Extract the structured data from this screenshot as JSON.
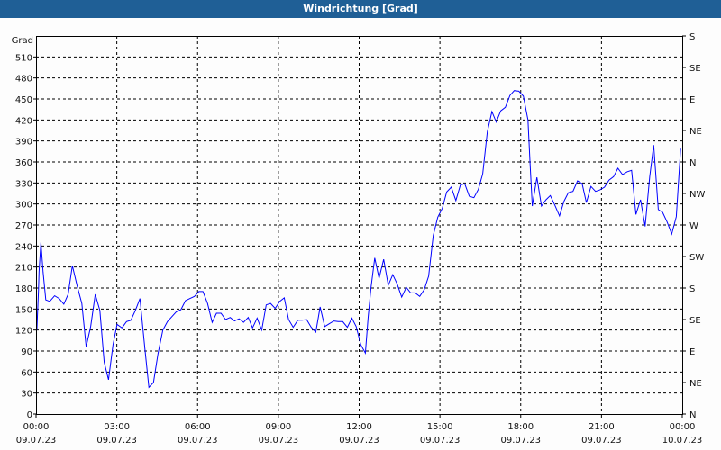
{
  "window": {
    "title": "Windrichtung [Grad]"
  },
  "chart_data": {
    "type": "line",
    "title": "Windrichtung [Grad]",
    "ylabel": "Grad",
    "ylim": [
      0,
      540
    ],
    "yticks": [
      0,
      30,
      60,
      90,
      120,
      150,
      180,
      210,
      240,
      270,
      300,
      330,
      360,
      390,
      420,
      450,
      480,
      510
    ],
    "xlim_hours": [
      0,
      24
    ],
    "xticks": [
      {
        "hour": 0,
        "time": "00:00",
        "date": "09.07.23"
      },
      {
        "hour": 3,
        "time": "03:00",
        "date": "09.07.23"
      },
      {
        "hour": 6,
        "time": "06:00",
        "date": "09.07.23"
      },
      {
        "hour": 9,
        "time": "09:00",
        "date": "09.07.23"
      },
      {
        "hour": 12,
        "time": "12:00",
        "date": "09.07.23"
      },
      {
        "hour": 15,
        "time": "15:00",
        "date": "09.07.23"
      },
      {
        "hour": 18,
        "time": "18:00",
        "date": "09.07.23"
      },
      {
        "hour": 21,
        "time": "21:00",
        "date": "09.07.23"
      },
      {
        "hour": 24,
        "time": "00:00",
        "date": "10.07.23"
      }
    ],
    "right_axis": [
      {
        "value": 0,
        "label": "N"
      },
      {
        "value": 45,
        "label": "NE"
      },
      {
        "value": 90,
        "label": "E"
      },
      {
        "value": 135,
        "label": "SE"
      },
      {
        "value": 180,
        "label": "S"
      },
      {
        "value": 225,
        "label": "SW"
      },
      {
        "value": 270,
        "label": "W"
      },
      {
        "value": 315,
        "label": "NW"
      },
      {
        "value": 360,
        "label": "N"
      },
      {
        "value": 405,
        "label": "NE"
      },
      {
        "value": 450,
        "label": "E"
      },
      {
        "value": 495,
        "label": "SE"
      },
      {
        "value": 540,
        "label": "S"
      }
    ],
    "grid": true,
    "series": [
      {
        "name": "Windrichtung",
        "color": "#0000ff",
        "points": [
          [
            0.03,
            120
          ],
          [
            0.09,
            176
          ],
          [
            0.11,
            203
          ],
          [
            0.18,
            245
          ],
          [
            0.26,
            203
          ],
          [
            0.36,
            163
          ],
          [
            0.51,
            161
          ],
          [
            0.69,
            169
          ],
          [
            0.86,
            165
          ],
          [
            1.03,
            157
          ],
          [
            1.19,
            171
          ],
          [
            1.35,
            212
          ],
          [
            1.52,
            184
          ],
          [
            1.7,
            158
          ],
          [
            1.86,
            96
          ],
          [
            2.03,
            125
          ],
          [
            2.2,
            171
          ],
          [
            2.37,
            148
          ],
          [
            2.53,
            74
          ],
          [
            2.69,
            49
          ],
          [
            2.86,
            99
          ],
          [
            3.01,
            128
          ],
          [
            3.19,
            123
          ],
          [
            3.36,
            132
          ],
          [
            3.52,
            134
          ],
          [
            3.69,
            148
          ],
          [
            3.86,
            165
          ],
          [
            4.04,
            94
          ],
          [
            4.19,
            38
          ],
          [
            4.36,
            45
          ],
          [
            4.53,
            86
          ],
          [
            4.71,
            120
          ],
          [
            4.88,
            132
          ],
          [
            5.04,
            139
          ],
          [
            5.21,
            146
          ],
          [
            5.38,
            149
          ],
          [
            5.55,
            162
          ],
          [
            5.71,
            165
          ],
          [
            5.88,
            168
          ],
          [
            6.05,
            175
          ],
          [
            6.2,
            175
          ],
          [
            6.37,
            158
          ],
          [
            6.54,
            131
          ],
          [
            6.7,
            144
          ],
          [
            6.87,
            144
          ],
          [
            7.04,
            135
          ],
          [
            7.21,
            138
          ],
          [
            7.37,
            133
          ],
          [
            7.54,
            136
          ],
          [
            7.71,
            131
          ],
          [
            7.88,
            138
          ],
          [
            8.04,
            123
          ],
          [
            8.21,
            137
          ],
          [
            8.38,
            120
          ],
          [
            8.55,
            156
          ],
          [
            8.71,
            158
          ],
          [
            8.88,
            151
          ],
          [
            9.05,
            161
          ],
          [
            9.22,
            166
          ],
          [
            9.38,
            135
          ],
          [
            9.55,
            124
          ],
          [
            9.72,
            134
          ],
          [
            9.88,
            134
          ],
          [
            10.05,
            135
          ],
          [
            10.22,
            124
          ],
          [
            10.39,
            117
          ],
          [
            10.55,
            153
          ],
          [
            10.72,
            125
          ],
          [
            10.89,
            129
          ],
          [
            11.06,
            133
          ],
          [
            11.22,
            132
          ],
          [
            11.39,
            132
          ],
          [
            11.56,
            124
          ],
          [
            11.73,
            137
          ],
          [
            11.89,
            125
          ],
          [
            12.06,
            99
          ],
          [
            12.23,
            87
          ],
          [
            12.33,
            137
          ],
          [
            12.44,
            180
          ],
          [
            12.58,
            223
          ],
          [
            12.74,
            194
          ],
          [
            12.91,
            221
          ],
          [
            13.08,
            184
          ],
          [
            13.25,
            199
          ],
          [
            13.41,
            186
          ],
          [
            13.58,
            167
          ],
          [
            13.75,
            181
          ],
          [
            13.91,
            173
          ],
          [
            14.08,
            173
          ],
          [
            14.25,
            168
          ],
          [
            14.42,
            178
          ],
          [
            14.58,
            197
          ],
          [
            14.75,
            255
          ],
          [
            14.92,
            281
          ],
          [
            15.09,
            294
          ],
          [
            15.25,
            317
          ],
          [
            15.42,
            324
          ],
          [
            15.59,
            305
          ],
          [
            15.76,
            327
          ],
          [
            15.92,
            329
          ],
          [
            16.09,
            311
          ],
          [
            16.26,
            309
          ],
          [
            16.43,
            321
          ],
          [
            16.59,
            343
          ],
          [
            16.76,
            403
          ],
          [
            16.93,
            432
          ],
          [
            17.09,
            417
          ],
          [
            17.26,
            433
          ],
          [
            17.43,
            438
          ],
          [
            17.6,
            455
          ],
          [
            17.76,
            462
          ],
          [
            17.93,
            461
          ],
          [
            18.1,
            454
          ],
          [
            18.27,
            420
          ],
          [
            18.35,
            356
          ],
          [
            18.43,
            297
          ],
          [
            18.6,
            338
          ],
          [
            18.77,
            297
          ],
          [
            18.94,
            306
          ],
          [
            19.1,
            312
          ],
          [
            19.27,
            298
          ],
          [
            19.44,
            283
          ],
          [
            19.61,
            304
          ],
          [
            19.77,
            316
          ],
          [
            19.94,
            318
          ],
          [
            20.11,
            333
          ],
          [
            20.28,
            329
          ],
          [
            20.44,
            302
          ],
          [
            20.61,
            325
          ],
          [
            20.78,
            318
          ],
          [
            20.94,
            320
          ],
          [
            21.11,
            324
          ],
          [
            21.28,
            334
          ],
          [
            21.45,
            339
          ],
          [
            21.61,
            351
          ],
          [
            21.78,
            342
          ],
          [
            21.95,
            346
          ],
          [
            22.12,
            348
          ],
          [
            22.28,
            285
          ],
          [
            22.45,
            306
          ],
          [
            22.62,
            268
          ],
          [
            22.79,
            339
          ],
          [
            22.94,
            384
          ],
          [
            23.11,
            292
          ],
          [
            23.27,
            288
          ],
          [
            23.44,
            274
          ],
          [
            23.61,
            257
          ],
          [
            23.78,
            282
          ],
          [
            23.94,
            379
          ]
        ]
      }
    ]
  }
}
